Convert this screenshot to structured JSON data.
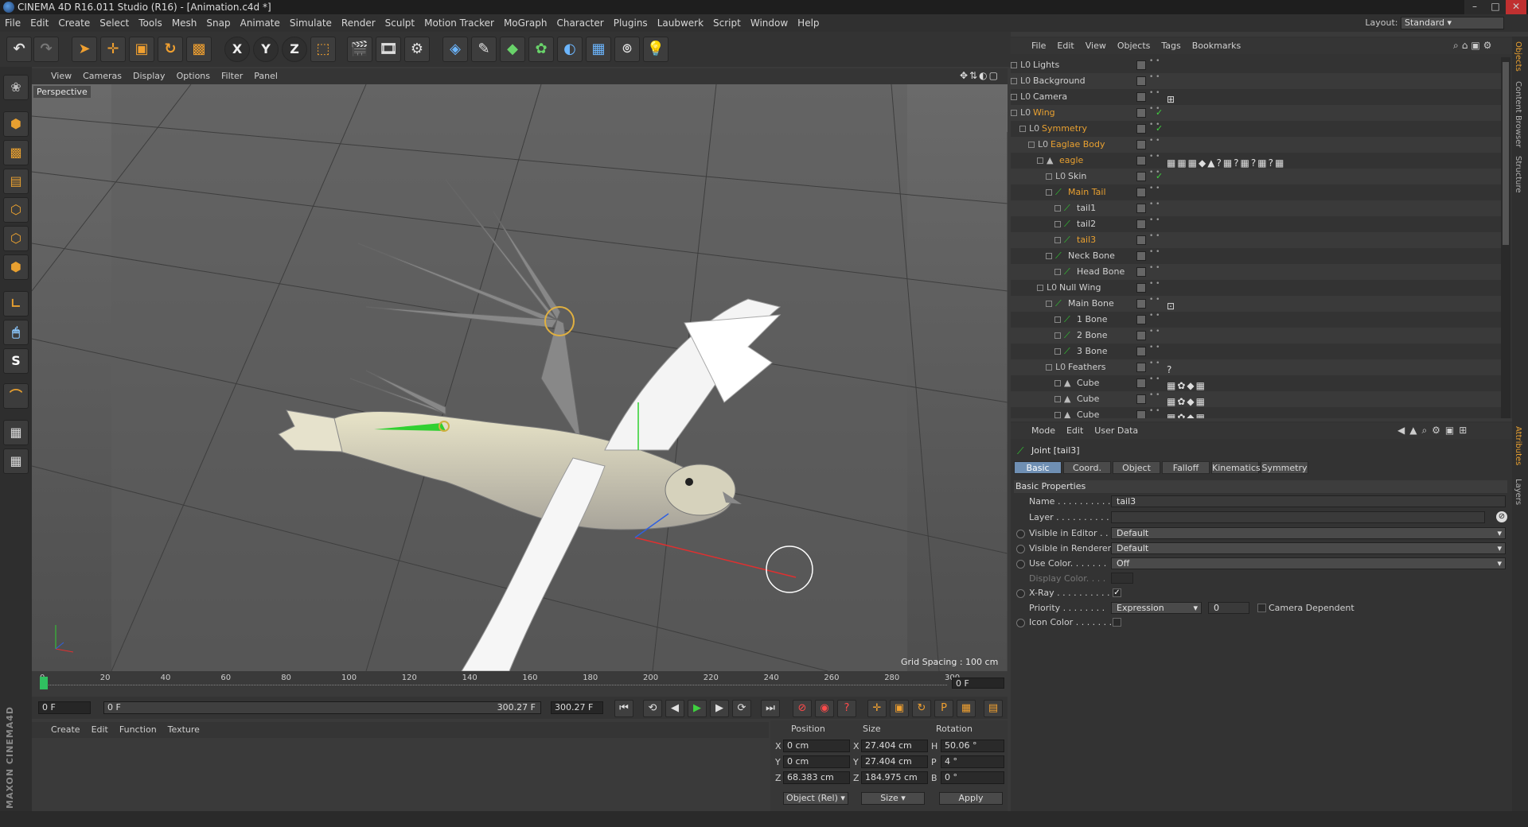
{
  "window": {
    "title": "CINEMA 4D R16.011 Studio (R16) - [Animation.c4d *]"
  },
  "menu": [
    "File",
    "Edit",
    "Create",
    "Select",
    "Tools",
    "Mesh",
    "Snap",
    "Animate",
    "Simulate",
    "Render",
    "Sculpt",
    "Motion Tracker",
    "MoGraph",
    "Character",
    "Plugins",
    "Laubwerk",
    "Script",
    "Window",
    "Help"
  ],
  "layout": {
    "label": "Layout:",
    "value": "Standard"
  },
  "toolbar_icons": [
    "undo-icon",
    "redo-icon",
    "live-selection-icon",
    "move-icon",
    "scale-icon",
    "rotate-icon",
    "recent-tools-icon",
    "x-axis-icon",
    "y-axis-icon",
    "z-axis-icon",
    "coordinate-system-icon",
    "render-view-icon",
    "render-picture-viewer-icon",
    "edit-render-settings-icon",
    "cube-icon",
    "spline-pen-icon",
    "subdivision-icon",
    "array-icon",
    "deformer-icon",
    "floor-icon",
    "camera-icon",
    "light-icon"
  ],
  "viewport": {
    "menu": [
      "View",
      "Cameras",
      "Display",
      "Options",
      "Filter",
      "Panel"
    ],
    "label": "Perspective",
    "grid_spacing": "Grid Spacing : 100 cm"
  },
  "timeline": {
    "ticks": [
      "0",
      "20",
      "40",
      "60",
      "80",
      "100",
      "120",
      "140",
      "160",
      "180",
      "200",
      "220",
      "240",
      "260",
      "280",
      "300"
    ],
    "current": "0 F",
    "start": "0 F",
    "slider_start": "0 F",
    "slider_end": "300.27 F",
    "end": "300.27 F"
  },
  "material_manager": {
    "menu": [
      "Create",
      "Edit",
      "Function",
      "Texture"
    ]
  },
  "coordinates": {
    "headers": {
      "position": "Position",
      "size": "Size",
      "rotation": "Rotation"
    },
    "rows": [
      {
        "axis": "X",
        "pos": "0 cm",
        "size_axis": "X",
        "size": "27.404 cm",
        "rot_axis": "H",
        "rot": "50.06 °"
      },
      {
        "axis": "Y",
        "pos": "0 cm",
        "size_axis": "Y",
        "size": "27.404 cm",
        "rot_axis": "P",
        "rot": "4 °"
      },
      {
        "axis": "Z",
        "pos": "68.383 cm",
        "size_axis": "Z",
        "size": "184.975 cm",
        "rot_axis": "B",
        "rot": "0 °"
      }
    ],
    "mode": "Object (Rel)",
    "size_mode": "Size",
    "apply": "Apply"
  },
  "object_manager": {
    "menu": [
      "File",
      "Edit",
      "View",
      "Objects",
      "Tags",
      "Bookmarks"
    ],
    "objects": [
      {
        "name": "Lights",
        "indent": 0,
        "selected": false,
        "tags": "",
        "check": false
      },
      {
        "name": "Background",
        "indent": 0,
        "selected": false,
        "tags": "",
        "check": false
      },
      {
        "name": "Camera",
        "indent": 0,
        "selected": false,
        "tags": "⊞",
        "check": false
      },
      {
        "name": "Wing",
        "indent": 0,
        "selected": true,
        "tags": "",
        "check": true
      },
      {
        "name": "Symmetry",
        "indent": 1,
        "selected": true,
        "tags": "",
        "check": true
      },
      {
        "name": "Eaglae Body",
        "indent": 2,
        "selected": true,
        "tags": "",
        "check": false
      },
      {
        "name": "eagle",
        "indent": 3,
        "selected": true,
        "tags": "▦▦▦◆▲?▦?▦?▦?▦",
        "check": false
      },
      {
        "name": "Skin",
        "indent": 4,
        "selected": false,
        "tags": "",
        "check": true
      },
      {
        "name": "Main Tail",
        "indent": 4,
        "selected": true,
        "tags": "",
        "check": false
      },
      {
        "name": "tail1",
        "indent": 5,
        "selected": false,
        "tags": "",
        "check": false
      },
      {
        "name": "tail2",
        "indent": 5,
        "selected": false,
        "tags": "",
        "check": false
      },
      {
        "name": "tail3",
        "indent": 5,
        "selected": true,
        "tags": "",
        "check": false
      },
      {
        "name": "Neck Bone",
        "indent": 4,
        "selected": false,
        "tags": "",
        "check": false
      },
      {
        "name": "Head Bone",
        "indent": 5,
        "selected": false,
        "tags": "",
        "check": false
      },
      {
        "name": "Null Wing",
        "indent": 3,
        "selected": false,
        "tags": "",
        "check": false
      },
      {
        "name": "Main Bone",
        "indent": 4,
        "selected": false,
        "tags": "⊡",
        "check": false
      },
      {
        "name": "1 Bone",
        "indent": 5,
        "selected": false,
        "tags": "",
        "check": false
      },
      {
        "name": "2 Bone",
        "indent": 5,
        "selected": false,
        "tags": "",
        "check": false
      },
      {
        "name": "3 Bone",
        "indent": 5,
        "selected": false,
        "tags": "",
        "check": false
      },
      {
        "name": "Feathers",
        "indent": 4,
        "selected": false,
        "tags": "?",
        "check": false
      },
      {
        "name": "Cube",
        "indent": 5,
        "selected": false,
        "tags": "▦✿◆▦",
        "check": false
      },
      {
        "name": "Cube",
        "indent": 5,
        "selected": false,
        "tags": "▦✿◆▦",
        "check": false
      },
      {
        "name": "Cube",
        "indent": 5,
        "selected": false,
        "tags": "▦✿◆▦",
        "check": false
      }
    ]
  },
  "attributes": {
    "menu": [
      "Mode",
      "Edit",
      "User Data"
    ],
    "title": "Joint [tail3]",
    "tabs": [
      "Basic",
      "Coord.",
      "Object",
      "Falloff",
      "Kinematics",
      "Symmetry"
    ],
    "section": "Basic Properties",
    "fields": {
      "name_label": "Name . . . . . . . . . . .",
      "name_value": "tail3",
      "layer_label": "Layer . . . . . . . . . . .",
      "vis_editor_label": "Visible in Editor . .",
      "vis_editor_value": "Default",
      "vis_render_label": "Visible in Renderer",
      "vis_render_value": "Default",
      "use_color_label": "Use Color. . . . . . .",
      "use_color_value": "Off",
      "display_color_label": "Display Color. . . .",
      "xray_label": "X-Ray . . . . . . . . . .",
      "priority_label": "Priority . . . . . . . .",
      "priority_value": "Expression",
      "priority_num": "0",
      "camera_dep_label": "Camera Dependent",
      "icon_color_label": "Icon Color . . . . . . ."
    }
  },
  "side_tabs": [
    "Objects",
    "Content Browser",
    "Structure",
    "Attributes",
    "Layers"
  ],
  "colors": {
    "accent": "#e8a030",
    "selection_blue": "#6f8fb3",
    "axis_red": "#e03030",
    "axis_green": "#30d030",
    "axis_blue": "#3060e0"
  }
}
